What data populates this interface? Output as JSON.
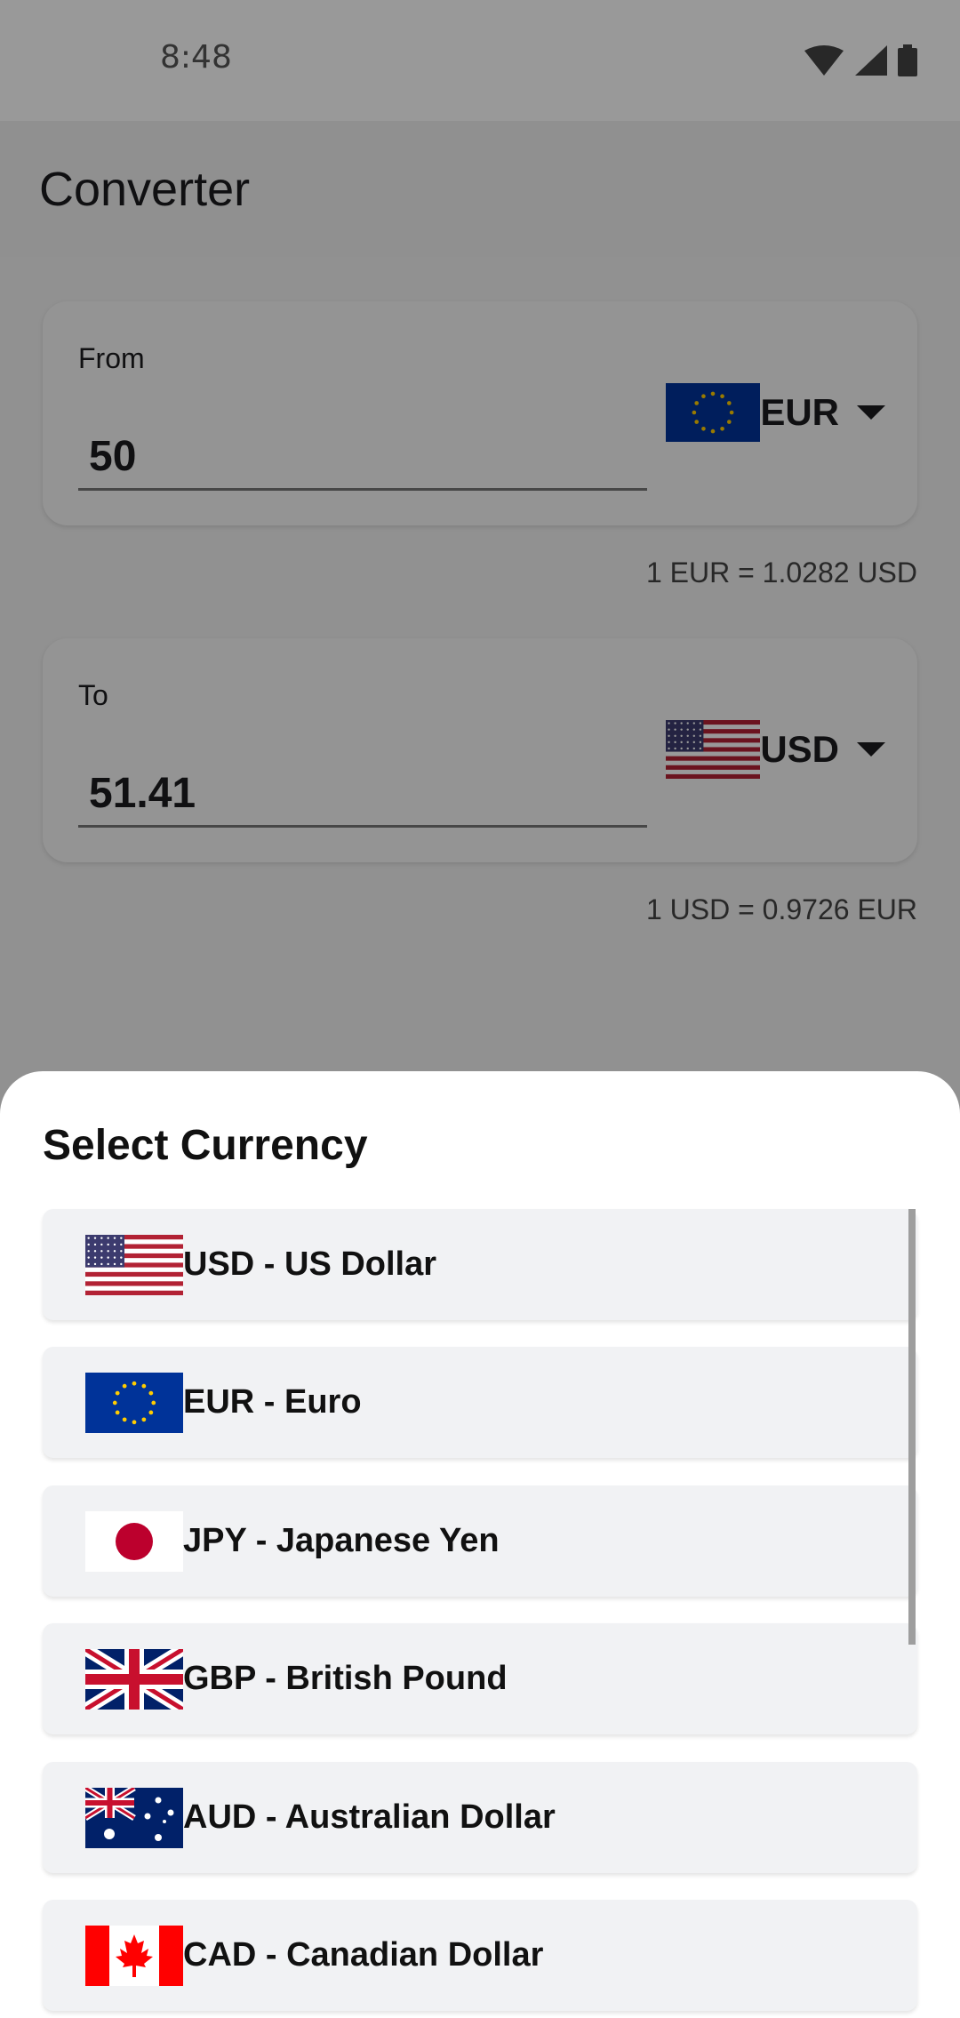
{
  "status_bar": {
    "time": "8:48"
  },
  "app": {
    "title": "Converter"
  },
  "from_card": {
    "label": "From",
    "amount": "50",
    "currency": "EUR",
    "rate": "1 EUR = 1.0282 USD"
  },
  "to_card": {
    "label": "To",
    "amount": "51.41",
    "currency": "USD",
    "rate": "1 USD = 0.9726 EUR"
  },
  "sheet": {
    "title": "Select Currency",
    "items": [
      {
        "label": "USD - US Dollar",
        "flag": "us-flag-icon"
      },
      {
        "label": "EUR - Euro",
        "flag": "eu-flag-icon"
      },
      {
        "label": "JPY - Japanese Yen",
        "flag": "japan-flag-icon"
      },
      {
        "label": "GBP - British Pound",
        "flag": "uk-flag-icon"
      },
      {
        "label": "AUD - Australian Dollar",
        "flag": "australia-flag-icon"
      },
      {
        "label": "CAD - Canadian Dollar",
        "flag": "canada-flag-icon"
      }
    ]
  },
  "colors": {
    "eu_blue": "#003399",
    "eu_gold": "#FFCC00",
    "us_red": "#B22234",
    "us_blue": "#3C3B6E",
    "japan_red": "#BC002D",
    "uk_blue": "#012169",
    "uk_red": "#C8102E",
    "canada_red": "#FF0000"
  }
}
